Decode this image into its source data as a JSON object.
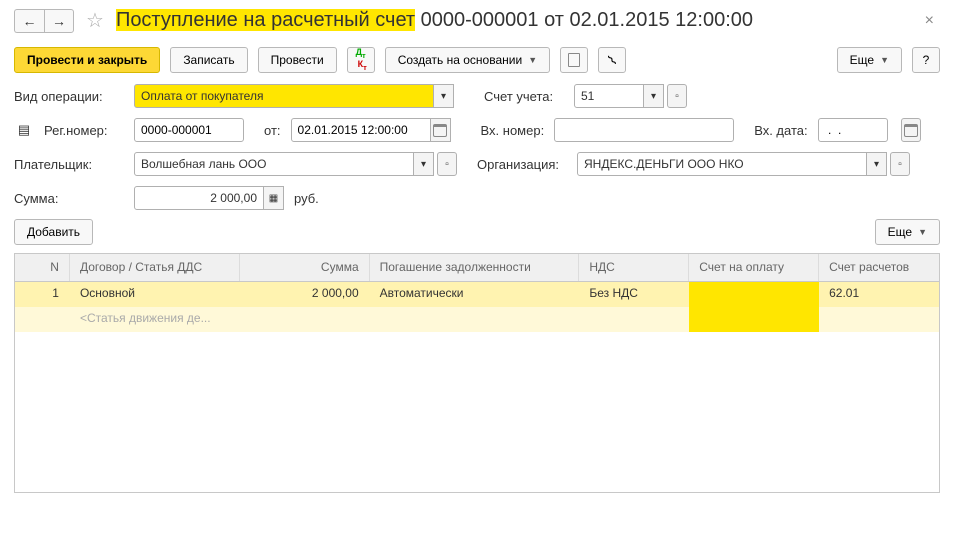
{
  "title": {
    "hl": "Поступление на расчетный счет",
    "rest": " 0000-000001 от 02.01.2015 12:00:00"
  },
  "toolbar": {
    "post_close": "Провести и закрыть",
    "write": "Записать",
    "post": "Провести",
    "create_based": "Создать на основании",
    "more": "Еще",
    "help": "?"
  },
  "form": {
    "op_type_label": "Вид операции:",
    "op_type_value": "Оплата от покупателя",
    "acct_label": "Счет учета:",
    "acct_value": "51",
    "reg_num_label": "Рег.номер:",
    "reg_num_value": "0000-000001",
    "from_label": "от:",
    "from_value": "02.01.2015 12:00:00",
    "in_num_label": "Вх. номер:",
    "in_num_value": "",
    "in_date_label": "Вх. дата:",
    "in_date_value": " .  .    ",
    "payer_label": "Плательщик:",
    "payer_value": "Волшебная лань ООО",
    "org_label": "Организация:",
    "org_value": "ЯНДЕКС.ДЕНЬГИ ООО НКО",
    "sum_label": "Сумма:",
    "sum_value": "2 000,00",
    "currency": "руб."
  },
  "subtoolbar": {
    "add": "Добавить",
    "more": "Еще"
  },
  "table": {
    "headers": {
      "n": "N",
      "dog": "Договор / Статья ДДС",
      "sum": "Сумма",
      "pog": "Погашение задолженности",
      "nds": "НДС",
      "schet": "Счет на оплату",
      "rasch": "Счет расчетов"
    },
    "rows": [
      {
        "n": "1",
        "dog": "Основной",
        "sum": "2 000,00",
        "pog": "Автоматически",
        "nds": "Без НДС",
        "schet": "",
        "rasch": "62.01"
      }
    ],
    "dds_placeholder": "<Статья движения де..."
  }
}
